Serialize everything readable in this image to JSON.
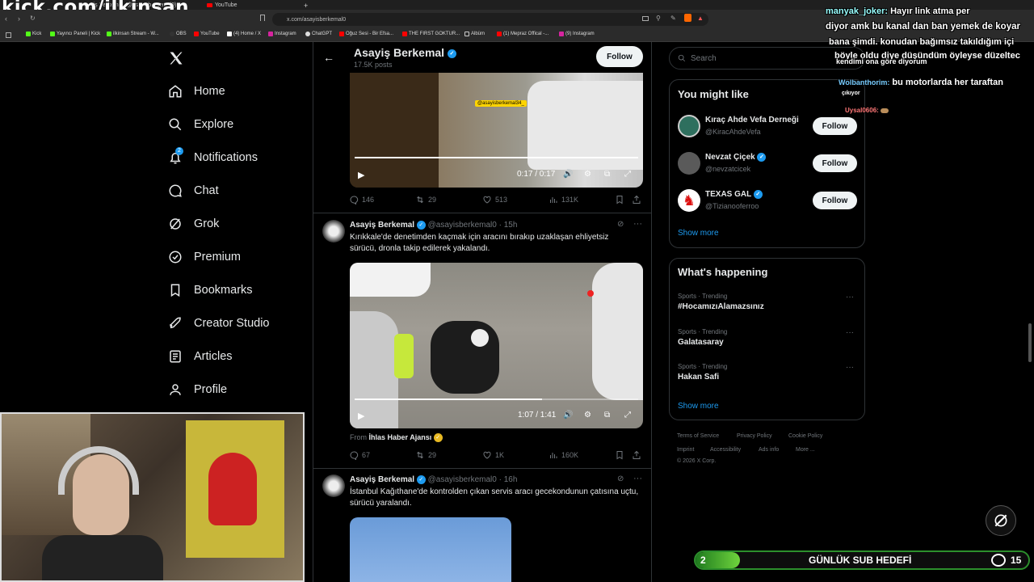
{
  "browser": {
    "tabs": [
      "Asayiş Berkemal (@asayisberkemal0)",
      "YouTube"
    ],
    "url": "x.com/asayisberkemal0",
    "bookmarks": [
      "Kick",
      "Yayıncı Paneli | Kick",
      "ilkinsan Stream - W...",
      "OBS",
      "YouTube",
      "(4) Home / X",
      "Instagram",
      "ChatGPT",
      "Oğuz Sesi - Bir Efsa...",
      "THE FIRST GOKTUR...",
      "Albüm",
      "(1) Mepraz Offical -...",
      "(9) Instagram"
    ]
  },
  "overlay": {
    "kick_url": "kick.com/ilkinsan",
    "sub_goal_count": "2",
    "sub_goal_label": "GÜNLÜK SUB HEDEFİ",
    "chat_count": "15",
    "bottom_icon": "slash-logo-icon"
  },
  "nav": {
    "logo": "x-logo-icon",
    "items": [
      {
        "label": "Home",
        "icon": "home-icon"
      },
      {
        "label": "Explore",
        "icon": "search-icon"
      },
      {
        "label": "Notifications",
        "icon": "bell-icon",
        "badge": "2"
      },
      {
        "label": "Chat",
        "icon": "chat-icon"
      },
      {
        "label": "Grok",
        "icon": "grok-icon"
      },
      {
        "label": "Premium",
        "icon": "premium-icon"
      },
      {
        "label": "Bookmarks",
        "icon": "bookmark-icon"
      },
      {
        "label": "Creator Studio",
        "icon": "rocket-icon"
      },
      {
        "label": "Articles",
        "icon": "articles-icon"
      },
      {
        "label": "Profile",
        "icon": "person-icon"
      }
    ]
  },
  "profile_header": {
    "name": "Asayiş Berkemal",
    "posts": "17.5K posts",
    "follow_label": "Follow"
  },
  "tweets": [
    {
      "video_time": "0:17 / 0:17",
      "video_watermark": "@asayisberkemal34_",
      "video_progress": 1.0,
      "replies": "146",
      "reposts": "29",
      "likes": "513",
      "views": "131K"
    },
    {
      "name": "Asayiş Berkemal",
      "handle": "@asayisberkemal0",
      "time": "· 15h",
      "text": "Kırıkkale'de denetimden kaçmak için aracını bırakıp uzaklaşan ehliyetsiz sürücü, dronla takip edilerek yakalandı.",
      "video_time": "1:07 / 1:41",
      "video_progress": 0.66,
      "from_prefix": "From",
      "from_source": "İhlas Haber Ajansı",
      "replies": "67",
      "reposts": "29",
      "likes": "1K",
      "views": "160K"
    },
    {
      "name": "Asayiş Berkemal",
      "handle": "@asayisberkemal0",
      "time": "· 16h",
      "text": "İstanbul Kağıthane'de kontrolden çıkan servis aracı gecekondunun çatısına uçtu, sürücü yaralandı."
    }
  ],
  "search": {
    "placeholder": "Search"
  },
  "might_like": {
    "title": "You might like",
    "users": [
      {
        "name": "Kıraç Ahde Vefa Derneği",
        "handle": "@KiracAhdeVefa",
        "follow": "Follow",
        "avatar_color": "#2e6f5e"
      },
      {
        "name": "Nevzat Çiçek",
        "handle": "@nevzatcicek",
        "follow": "Follow",
        "avatar_color": "#5a5a5a",
        "verified": true
      },
      {
        "name": "TEXAS GAL",
        "handle": "@Tizianooferroo",
        "follow": "Follow",
        "avatar_color": "#d11",
        "verified": true
      }
    ],
    "show_more": "Show more"
  },
  "happening": {
    "title": "What's happening",
    "trends": [
      {
        "category": "Sports · Trending",
        "name": "#HocamızıAlamazsınız"
      },
      {
        "category": "Sports · Trending",
        "name": "Galatasaray"
      },
      {
        "category": "Sports · Trending",
        "name": "Hakan Safi"
      }
    ],
    "show_more": "Show more"
  },
  "footer": {
    "links": [
      "Terms of Service",
      "Privacy Policy",
      "Cookie Policy",
      "Imprint",
      "Accessibility",
      "Ads info",
      "More ..."
    ],
    "copyright": "© 2026 X Corp."
  },
  "chat": [
    {
      "user": "manyak_joker:",
      "text": "Hayır link atma per",
      "user_color": "#9ff"
    },
    {
      "user": "",
      "text": "diyor amk bu kanal dan ban yemek de koyar",
      "user_color": "#fff"
    },
    {
      "user": "",
      "text": "bana şimdi. konudan bağımsız takıldığım içi",
      "user_color": "#fff"
    },
    {
      "user": "",
      "text": "böyle oldu diye düşündüm öyleyse düzeltec",
      "user_color": "#fff"
    },
    {
      "user": "",
      "text": "kendimi ona göre diyorum",
      "user_color": "#fff"
    },
    {
      "user": "Wolbanthorim:",
      "text": "bu motorlarda her taraftan",
      "user_color": "#7cf"
    },
    {
      "user": "",
      "text": "çıkıyor",
      "user_color": "#fff"
    },
    {
      "user": "Uysal0606:",
      "text": "",
      "user_color": "#f77"
    }
  ]
}
